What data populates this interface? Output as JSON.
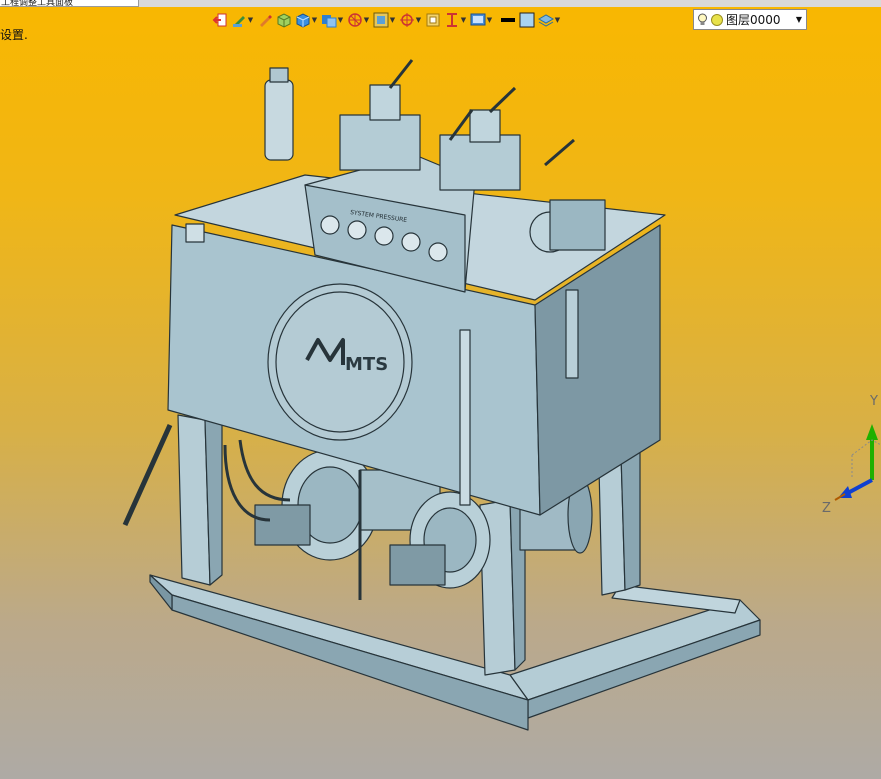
{
  "window": {
    "tab_fragment": "工程调整工具面板",
    "hint_text": "设置."
  },
  "toolbar": {
    "icons": [
      "return-icon",
      "pen-icon",
      "pencil-icon",
      "green-cube-icon",
      "blue-cube-icon",
      "layers-icon",
      "sketch-grid-icon",
      "frame-icon",
      "target-icon",
      "square-icon",
      "section-icon",
      "view-icon",
      "line-color-icon",
      "fill-color-icon",
      "layer-stack-icon"
    ]
  },
  "layer_selector": {
    "value": "图层0000"
  },
  "model": {
    "panel_label": "SYSTEM PRESSURE",
    "logo_text": "MTS",
    "nameplate_text": "MTS"
  },
  "triad": {
    "y_label": "Y",
    "z_label": "Z"
  },
  "colors": {
    "accent_orange": "#f9b700",
    "model_body": "#a9c4cf",
    "model_edge": "#27343a"
  }
}
